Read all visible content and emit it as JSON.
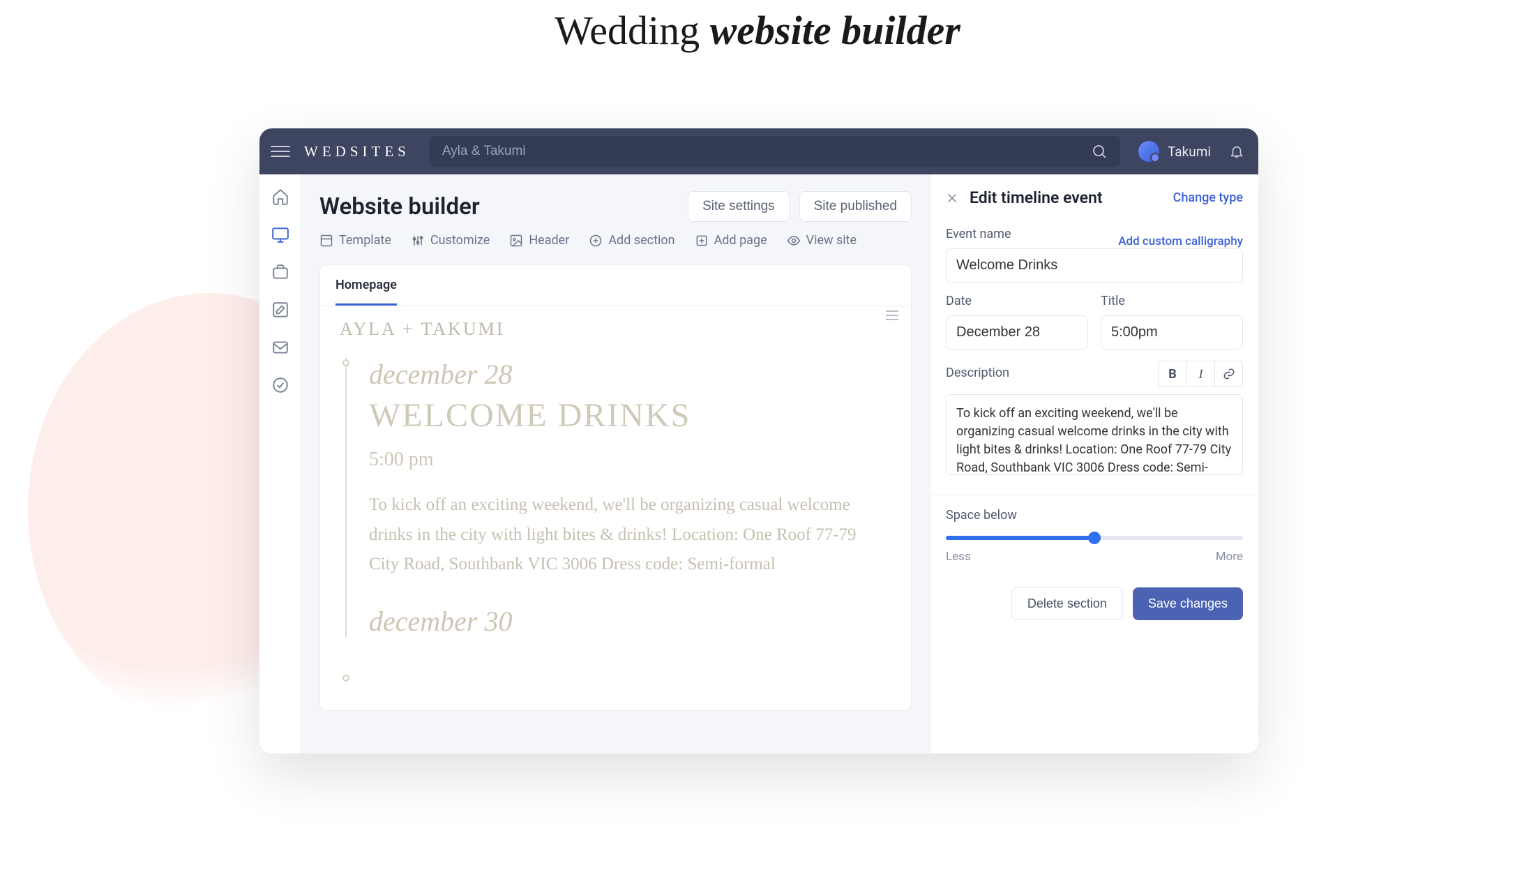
{
  "hero": {
    "prefix": "Wedding ",
    "emphasis": "website builder"
  },
  "topbar": {
    "brand": "WEDSITES",
    "search_placeholder": "Ayla & Takumi",
    "username": "Takumi"
  },
  "builder": {
    "title": "Website builder",
    "actions": {
      "settings": "Site settings",
      "published": "Site published"
    },
    "tools": {
      "template": "Template",
      "customize": "Customize",
      "header": "Header",
      "add_section": "Add section",
      "add_page": "Add page",
      "view_site": "View site"
    },
    "tab": "Homepage",
    "preview": {
      "couple": "AYLA + TAKUMI",
      "event1": {
        "date": "december 28",
        "title": "WELCOME DRINKS",
        "time": "5:00 pm",
        "desc": "To kick off an exciting weekend, we'll be organizing casual welcome drinks in the city with light bites & drinks! Location: One Roof 77-79 City Road, Southbank VIC 3006 Dress code: Semi-formal"
      },
      "event2": {
        "date": "december 30"
      }
    }
  },
  "panel": {
    "title": "Edit timeline event",
    "change_type": "Change type",
    "event_name_label": "Event name",
    "add_calligraphy": "Add custom calligraphy",
    "event_name_value": "Welcome Drinks",
    "date_label": "Date",
    "date_value": "December 28",
    "title_label": "Title",
    "title_value": "5:00pm",
    "desc_label": "Description",
    "desc_value": "To kick off an exciting weekend, we'll be organizing casual welcome drinks in the city with light bites & drinks! Location: One Roof 77-79 City Road, Southbank VIC 3006 Dress code: Semi-formal",
    "space_label": "Space below",
    "slider_value": 50,
    "less": "Less",
    "more": "More",
    "delete": "Delete section",
    "save": "Save changes"
  }
}
